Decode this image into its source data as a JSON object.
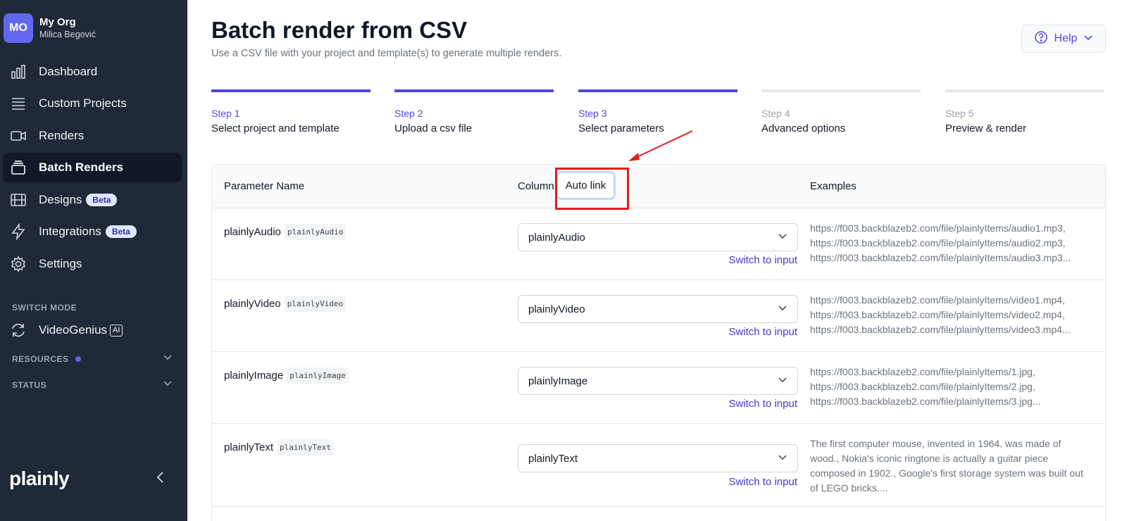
{
  "sidebar": {
    "org_initials": "MO",
    "org_name": "My Org",
    "user_name": "Milica Begović",
    "items": [
      {
        "label": "Dashboard"
      },
      {
        "label": "Custom Projects"
      },
      {
        "label": "Renders"
      },
      {
        "label": "Batch Renders"
      },
      {
        "label": "Designs",
        "badge": "Beta"
      },
      {
        "label": "Integrations",
        "badge": "Beta"
      },
      {
        "label": "Settings"
      }
    ],
    "switch_mode_label": "SWITCH MODE",
    "videogenius_label": "VideoGenius",
    "ai_badge": "AI",
    "resources_label": "RESOURCES",
    "status_label": "STATUS",
    "logo": "plainly"
  },
  "header": {
    "title": "Batch render from CSV",
    "subtitle": "Use a CSV file with your project and template(s) to generate multiple renders.",
    "help_label": "Help"
  },
  "steps": [
    {
      "num": "Step 1",
      "name": "Select project and template",
      "done": true
    },
    {
      "num": "Step 2",
      "name": "Upload a csv file",
      "done": true
    },
    {
      "num": "Step 3",
      "name": "Select parameters",
      "done": true
    },
    {
      "num": "Step 4",
      "name": "Advanced options",
      "done": false
    },
    {
      "num": "Step 5",
      "name": "Preview & render",
      "done": false
    }
  ],
  "table": {
    "col_param": "Parameter Name",
    "col_column": "Column",
    "auto_link": "Auto link",
    "col_examples": "Examples",
    "switch_label": "Switch to input",
    "rows": [
      {
        "name": "plainlyAudio",
        "code": "plainlyAudio",
        "selected": "plainlyAudio",
        "examples": "https://f003.backblazeb2.com/file/plainlyItems/audio1.mp3, https://f003.backblazeb2.com/file/plainlyItems/audio2.mp3, https://f003.backblazeb2.com/file/plainlyItems/audio3.mp3...",
        "ex_lines": [
          "https://f003.backblazeb2.com/file/plainlyItems/audio1.mp3,",
          "https://f003.backblazeb2.com/file/plainlyItems/audio2.mp3,",
          "https://f003.backblazeb2.com/file/plainlyItems/audio3.mp3..."
        ]
      },
      {
        "name": "plainlyVideo",
        "code": "plainlyVideo",
        "selected": "plainlyVideo",
        "ex_lines": [
          "https://f003.backblazeb2.com/file/plainlyItems/video1.mp4,",
          "https://f003.backblazeb2.com/file/plainlyItems/video2.mp4,",
          "https://f003.backblazeb2.com/file/plainlyItems/video3.mp4..."
        ]
      },
      {
        "name": "plainlyImage",
        "code": "plainlyImage",
        "selected": "plainlyImage",
        "ex_lines": [
          "https://f003.backblazeb2.com/file/plainlyItems/1.jpg,",
          "https://f003.backblazeb2.com/file/plainlyItems/2.jpg,",
          "https://f003.backblazeb2.com/file/plainlyItems/3.jpg..."
        ]
      },
      {
        "name": "plainlyText",
        "code": "plainlyText",
        "selected": "plainlyText",
        "examples_text": "The first computer mouse, invented in 1964, was made of wood., Nokia's iconic ringtone is actually a guitar piece composed in 1902., Google's first storage system was built out of LEGO bricks...."
      }
    ]
  },
  "colors": {
    "sidebar_bg": "#1f2937",
    "accent": "#4f46e5",
    "annotation_red": "#e11d1d"
  }
}
